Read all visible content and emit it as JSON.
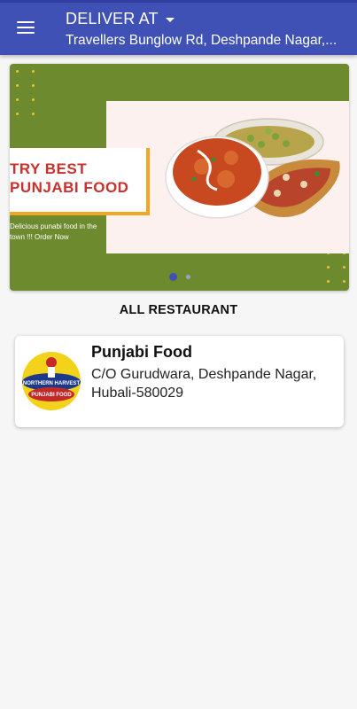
{
  "header": {
    "deliver_label": "DELIVER AT",
    "address": "Travellers Bunglow Rd, Deshpande Nagar,...",
    "bg_color": "#3f51b5"
  },
  "banner": {
    "title": "TRY BEST PUNJABI FOOD",
    "subtitle": "Delicious punabi food in the town !!! Order Now",
    "slides": 2,
    "active_slide": 1,
    "bg_color": "#6d8a2e",
    "accent_color": "#f4a623",
    "title_color": "#c9302c"
  },
  "section": {
    "title": "ALL RESTAURANT"
  },
  "restaurants": [
    {
      "name": "Punjabi Food",
      "address": "C/O Gurudwara, Deshpande Nagar, Hubali-580029",
      "logo_icon": "northern-harvest-logo"
    }
  ]
}
